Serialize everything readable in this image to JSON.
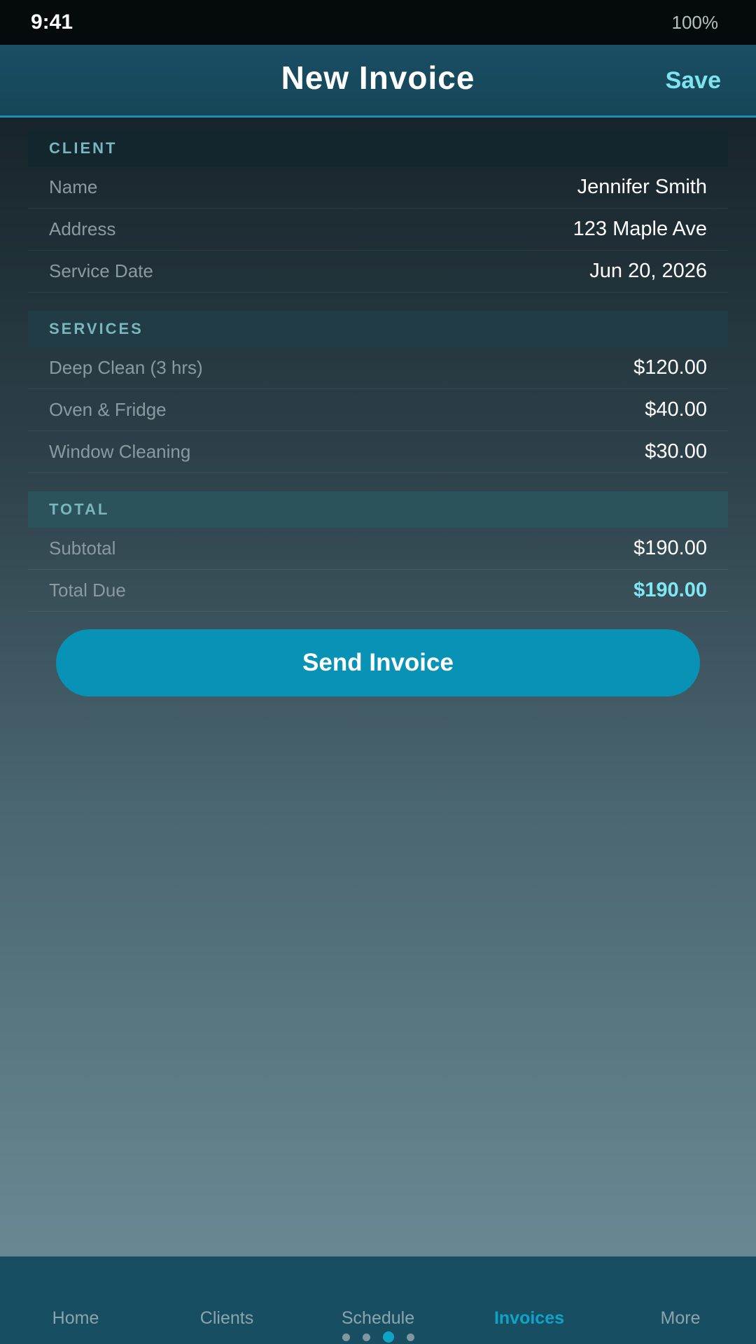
{
  "status_bar": {
    "time": "9:41",
    "battery": "100%"
  },
  "header": {
    "title": "New Invoice",
    "save_label": "Save"
  },
  "client": {
    "header": "CLIENT",
    "rows": [
      {
        "label": "Name",
        "value": "Jennifer Smith"
      },
      {
        "label": "Address",
        "value": "123 Maple Ave"
      },
      {
        "label": "Service Date",
        "value": "Jun 20, 2026"
      }
    ]
  },
  "services": {
    "header": "SERVICES",
    "rows": [
      {
        "label": "Deep Clean (3 hrs)",
        "value": "$120.00"
      },
      {
        "label": "Oven & Fridge",
        "value": "$40.00"
      },
      {
        "label": "Window Cleaning",
        "value": "$30.00"
      }
    ]
  },
  "total": {
    "header": "TOTAL",
    "rows": [
      {
        "label": "Subtotal",
        "value": "$190.00"
      },
      {
        "label": "Total Due",
        "value": "$190.00"
      }
    ]
  },
  "send_button_label": "Send Invoice",
  "tabs": [
    {
      "label": "Home",
      "active": false
    },
    {
      "label": "Clients",
      "active": false
    },
    {
      "label": "Schedule",
      "active": false
    },
    {
      "label": "Invoices",
      "active": true
    },
    {
      "label": "More",
      "active": false
    }
  ],
  "page_indicator": {
    "count": 4,
    "current": 3
  },
  "colors": {
    "accent": "#0892b6",
    "save_text": "#7fe3ee",
    "total_due": "#7fe8f2",
    "active_tab": "#0fa3c8"
  }
}
